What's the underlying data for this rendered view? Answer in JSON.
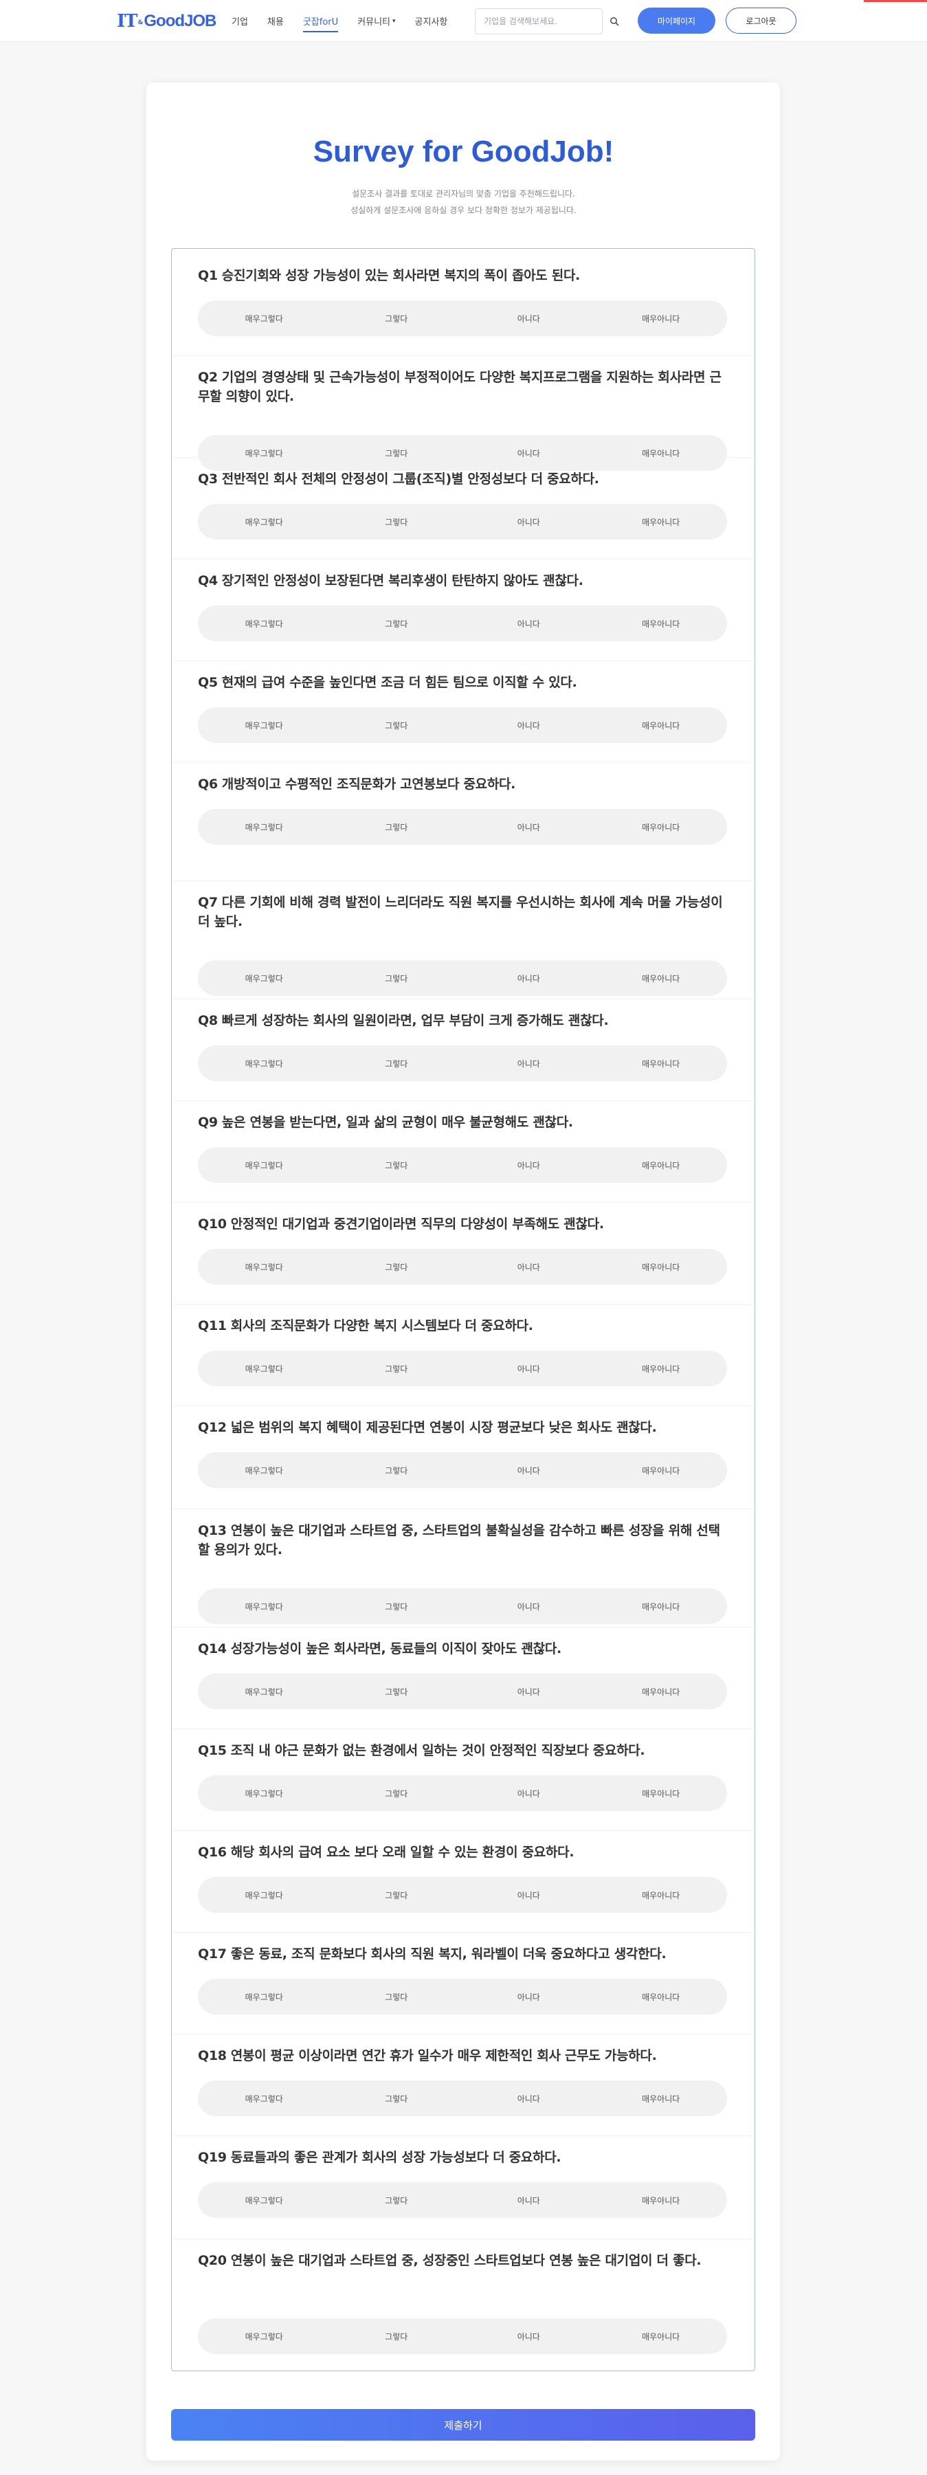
{
  "header": {
    "logo_it": "IT",
    "logo_amp": "&",
    "logo_goodjob": "GoodJOB",
    "nav": [
      {
        "label": "기업",
        "name": "nav-company",
        "dropdown": false
      },
      {
        "label": "채용",
        "name": "nav-recruit",
        "dropdown": false
      },
      {
        "label": "굿잡forU",
        "name": "nav-goodjob-for-u",
        "dropdown": false,
        "active": true
      },
      {
        "label": "커뮤니티",
        "name": "nav-community",
        "dropdown": true
      },
      {
        "label": "공지사항",
        "name": "nav-notice",
        "dropdown": false
      }
    ],
    "search_placeholder": "기업을 검색해보세요.",
    "mypage_label": "마이페이지",
    "logout_label": "로그아웃"
  },
  "colors": {
    "accent": "#3a63d6",
    "button": "#4a7cf0",
    "corner": "#f04a4a"
  },
  "survey": {
    "title": "Survey for GoodJob!",
    "subtitle_line1": "설문조사 결과를 토대로 관리자님의 맞춤 기업을 추천해드립니다.",
    "subtitle_line2": "성실하게 설문조사에 응하실 경우 보다 정확한 정보가 제공됩니다.",
    "options": [
      "매우그렇다",
      "그렇다",
      "아니다",
      "매우아니다"
    ],
    "questions": [
      {
        "num": "Q1",
        "text": "승진기회와 성장 가능성이 있는 회사라면 복지의 폭이 좁아도 된다."
      },
      {
        "num": "Q2",
        "text": "기업의 경영상태 및 근속가능성이 부정적이어도 다양한 복지프로그램을 지원하는 회사라면 근무할 의향이 있다."
      },
      {
        "num": "Q3",
        "text": "전반적인 회사 전체의 안정성이 그룹(조직)별 안정성보다 더 중요하다."
      },
      {
        "num": "Q4",
        "text": "장기적인 안정성이 보장된다면 복리후생이 탄탄하지 않아도 괜찮다."
      },
      {
        "num": "Q5",
        "text": "현재의 급여 수준을 높인다면 조금 더 힘든 팀으로 이직할 수 있다."
      },
      {
        "num": "Q6",
        "text": "개방적이고 수평적인 조직문화가 고연봉보다 중요하다."
      },
      {
        "num": "Q7",
        "text": "다른 기회에 비해 경력 발전이 느리더라도 직원 복지를 우선시하는 회사에 계속 머물 가능성이 더 높다."
      },
      {
        "num": "Q8",
        "text": "빠르게 성장하는 회사의 일원이라면, 업무 부담이 크게 증가해도 괜찮다."
      },
      {
        "num": "Q9",
        "text": "높은 연봉을 받는다면, 일과 삶의 균형이 매우 불균형해도 괜찮다."
      },
      {
        "num": "Q10",
        "text": "안정적인 대기업과 중견기업이라면 직무의 다양성이 부족해도 괜찮다."
      },
      {
        "num": "Q11",
        "text": "회사의 조직문화가 다양한 복지 시스템보다 더 중요하다."
      },
      {
        "num": "Q12",
        "text": "넓은 범위의 복지 혜택이 제공된다면 연봉이 시장 평균보다 낮은 회사도 괜찮다."
      },
      {
        "num": "Q13",
        "text": "연봉이 높은 대기업과 스타트업 중, 스타트업의 불확실성을 감수하고 빠른 성장을 위해 선택할 용의가 있다."
      },
      {
        "num": "Q14",
        "text": "성장가능성이 높은 회사라면, 동료들의 이직이 잦아도 괜찮다."
      },
      {
        "num": "Q15",
        "text": "조직 내 야근 문화가 없는 환경에서 일하는 것이 안정적인 직장보다 중요하다."
      },
      {
        "num": "Q16",
        "text": "해당 회사의 급여 요소 보다 오래 일할 수 있는 환경이 중요하다."
      },
      {
        "num": "Q17",
        "text": "좋은 동료, 조직 문화보다 회사의 직원 복지, 워라벨이 더욱 중요하다고 생각한다."
      },
      {
        "num": "Q18",
        "text": "연봉이 평균 이상이라면 연간 휴가 일수가 매우 제한적인 회사 근무도 가능하다."
      },
      {
        "num": "Q19",
        "text": "동료들과의 좋은 관계가 회사의 성장 가능성보다 더 중요하다."
      },
      {
        "num": "Q20",
        "text": "연봉이 높은 대기업과 스타트업 중, 성장중인 스타트업보다 연봉 높은 대기업이 더 좋다."
      }
    ],
    "submit_label": "제출하기"
  }
}
